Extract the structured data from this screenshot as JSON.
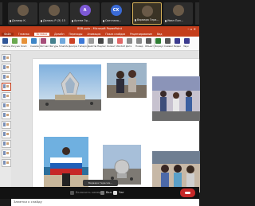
{
  "participants": [
    {
      "initials": "",
      "name": "Данияр К.",
      "style": "photo"
    },
    {
      "initials": "",
      "name": "Даниль Р (Э) 15",
      "style": "photo"
    },
    {
      "initials": "А",
      "name": "Артем Ор...",
      "style": "purple"
    },
    {
      "initials": "СХ",
      "name": "Светлана...",
      "style": "blue"
    },
    {
      "initials": "",
      "name": "Варвара Гера...",
      "style": "photo"
    },
    {
      "initials": "",
      "name": "Иван Пал...",
      "style": "photo"
    }
  ],
  "window": {
    "title": "ВВВ.pptx - Microsoft PowerPoint"
  },
  "menu": [
    "Главная",
    "Вставка",
    "Дизайн",
    "Переходы",
    "Анимация",
    "Показ слайдов",
    "Рецензирование",
    "Вид"
  ],
  "file_tab": "Файл",
  "ribbon": [
    {
      "label": "Таблица",
      "color": "#2f5597"
    },
    {
      "label": "Рисунок",
      "color": "#6aa84f"
    },
    {
      "label": "Клип",
      "color": "#e69138"
    },
    {
      "label": "Снимок",
      "color": "#3d85c6"
    },
    {
      "label": "Фотоальбом",
      "color": "#a64d79"
    },
    {
      "label": "Фигуры",
      "color": "#45818e"
    },
    {
      "label": "SmartArt",
      "color": "#6fa8dc"
    },
    {
      "label": "Диаграмма",
      "color": "#cc4125"
    },
    {
      "label": "Гиперссылка",
      "color": "#3c78d8"
    },
    {
      "label": "Действие",
      "color": "#999999"
    },
    {
      "label": "Надпись",
      "color": "#444444"
    },
    {
      "label": "Колонтитулы",
      "color": "#777777"
    },
    {
      "label": "WordArt",
      "color": "#e06666"
    },
    {
      "label": "Дата",
      "color": "#888888"
    },
    {
      "label": "Номер",
      "color": "#888888"
    },
    {
      "label": "Объект",
      "color": "#5b5b5b"
    },
    {
      "label": "Формула",
      "color": "#2e7d32"
    },
    {
      "label": "Символ",
      "color": "#555555"
    },
    {
      "label": "Видео",
      "color": "#3b3b8f"
    },
    {
      "label": "Звук",
      "color": "#3b3b8f"
    }
  ],
  "notes_placeholder": "Заметки к слайду",
  "share_banner": "Варвара Герасим...",
  "controls": {
    "camera": "Включить камеру",
    "mic": "Вкл.",
    "chat": "Чат"
  }
}
